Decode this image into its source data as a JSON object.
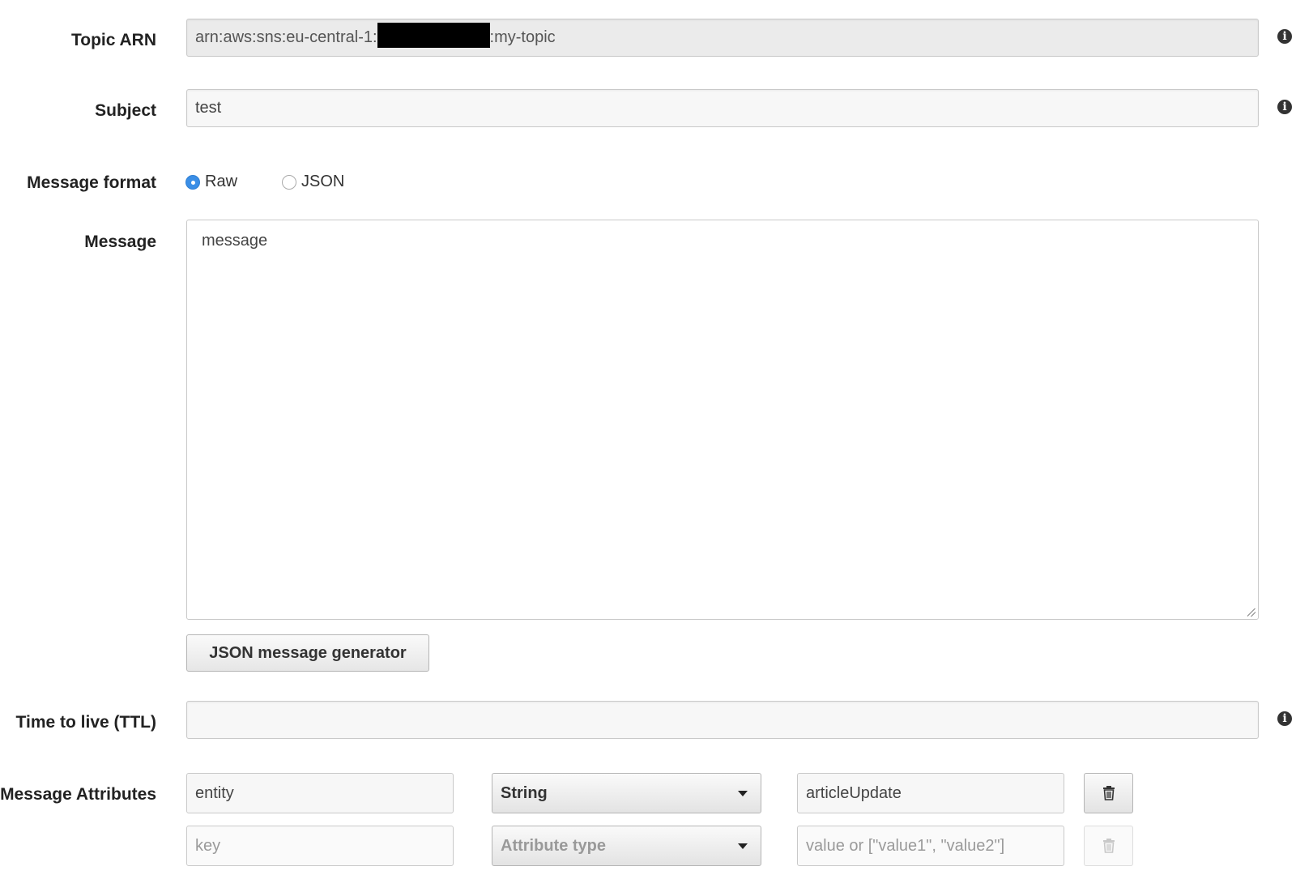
{
  "topic_arn": {
    "label": "Topic ARN",
    "prefix": "arn:aws:sns:eu-central-1:",
    "suffix": ":my-topic"
  },
  "subject": {
    "label": "Subject",
    "value": "test"
  },
  "message_format": {
    "label": "Message format",
    "options": [
      "Raw",
      "JSON"
    ],
    "selected": "Raw"
  },
  "message": {
    "label": "Message",
    "value": "message"
  },
  "json_generator_button": "JSON message generator",
  "ttl": {
    "label": "Time to live (TTL)",
    "value": ""
  },
  "message_attributes": {
    "label": "Message Attributes",
    "rows": [
      {
        "key": "entity",
        "type": "String",
        "value": "articleUpdate"
      },
      {
        "key_placeholder": "key",
        "type_placeholder": "Attribute type",
        "value_placeholder": "value or [\"value1\", \"value2\"]"
      }
    ]
  },
  "icons": {
    "info": "info-icon",
    "delete": "trash-icon",
    "dropdown": "caret-down-icon"
  },
  "colors": {
    "radio_selected": "#3a8ee6",
    "redaction": "#000000"
  }
}
